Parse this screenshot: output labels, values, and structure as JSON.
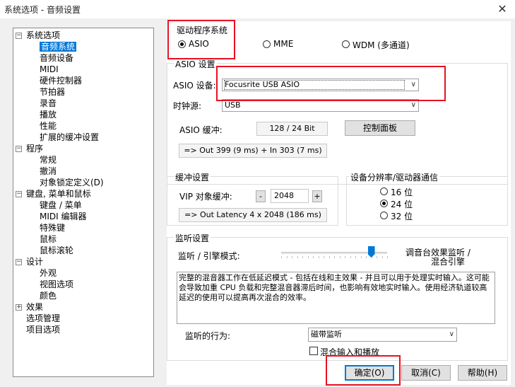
{
  "window": {
    "title": "系统选项 - 音频设置"
  },
  "tree": {
    "items": [
      {
        "label": "系统选项",
        "level": 0,
        "toggle": "−"
      },
      {
        "label": "音频系统",
        "level": 1,
        "selected": true
      },
      {
        "label": "音频设备",
        "level": 1
      },
      {
        "label": "MIDI",
        "level": 1
      },
      {
        "label": "硬件控制器",
        "level": 1
      },
      {
        "label": "节拍器",
        "level": 1
      },
      {
        "label": "录音",
        "level": 1
      },
      {
        "label": "播放",
        "level": 1
      },
      {
        "label": "性能",
        "level": 1
      },
      {
        "label": "扩展的缓冲设置",
        "level": 1
      },
      {
        "label": "程序",
        "level": 0,
        "toggle": "−"
      },
      {
        "label": "常规",
        "level": 1
      },
      {
        "label": "撤消",
        "level": 1
      },
      {
        "label": "对象锁定定义(D)",
        "level": 1
      },
      {
        "label": "键盘, 菜单和鼠标",
        "level": 0,
        "toggle": "−"
      },
      {
        "label": "键盘 / 菜单",
        "level": 1
      },
      {
        "label": "MIDI 编辑器",
        "level": 1
      },
      {
        "label": "特殊键",
        "level": 1
      },
      {
        "label": "鼠标",
        "level": 1
      },
      {
        "label": "鼠标滚轮",
        "level": 1
      },
      {
        "label": "设计",
        "level": 0,
        "toggle": "−"
      },
      {
        "label": "外观",
        "level": 1
      },
      {
        "label": "视图选项",
        "level": 1
      },
      {
        "label": "颜色",
        "level": 1
      },
      {
        "label": "效果",
        "level": 0,
        "toggle": "+"
      },
      {
        "label": "选项管理",
        "level": 0
      },
      {
        "label": "项目选项",
        "level": 0
      }
    ]
  },
  "driver": {
    "title": "驱动程序系统",
    "options": [
      {
        "label": "ASIO",
        "checked": true
      },
      {
        "label": "MME",
        "checked": false
      },
      {
        "label": "WDM (多通道)",
        "checked": false
      }
    ]
  },
  "asio": {
    "title": "ASIO 设置",
    "device_label": "ASIO 设备:",
    "device_value": "Focusrite USB ASIO",
    "clock_label": "时钟源:",
    "clock_value": "USB",
    "buffer_label": "ASIO 缓冲:",
    "buffer_value": "128 / 24 Bit",
    "control_panel": "控制面板",
    "latency": "=> Out 399 (9 ms) + In 303 (7 ms)"
  },
  "buffer": {
    "title": "缓冲设置",
    "vip_label": "VIP 对象缓冲:",
    "minus": "-",
    "value": "2048",
    "plus": "+",
    "latency": "=> Out Latency 4 x 2048 (186 ms)"
  },
  "resolution": {
    "title": "设备分辨率/驱动器通信",
    "options": [
      {
        "label": "16 位",
        "checked": false
      },
      {
        "label": "24 位",
        "checked": true
      },
      {
        "label": "32 位",
        "checked": false
      }
    ]
  },
  "monitor": {
    "title": "监听设置",
    "mode_label": "监听 / 引擎模式:",
    "mode_right_1": "调音台效果监听 /",
    "mode_right_2": "混合引擎",
    "slider_value": 0.85,
    "description": "完整的混音器工作在低延迟模式 - 包括在线和主效果 - 并且可以用于处理实时输入。这可能会导致加重 CPU 负载和完整混音器滞后时间，也影响有效地实时输入。使用经济轨道较高延迟的使用可以提高再次混合的效率。",
    "behavior_label": "监听的行为:",
    "behavior_value": "磁带监听",
    "mix_label": "混合输入和播放"
  },
  "buttons": {
    "ok": "确定(O)",
    "cancel": "取消(C)",
    "help": "帮助(H)"
  }
}
